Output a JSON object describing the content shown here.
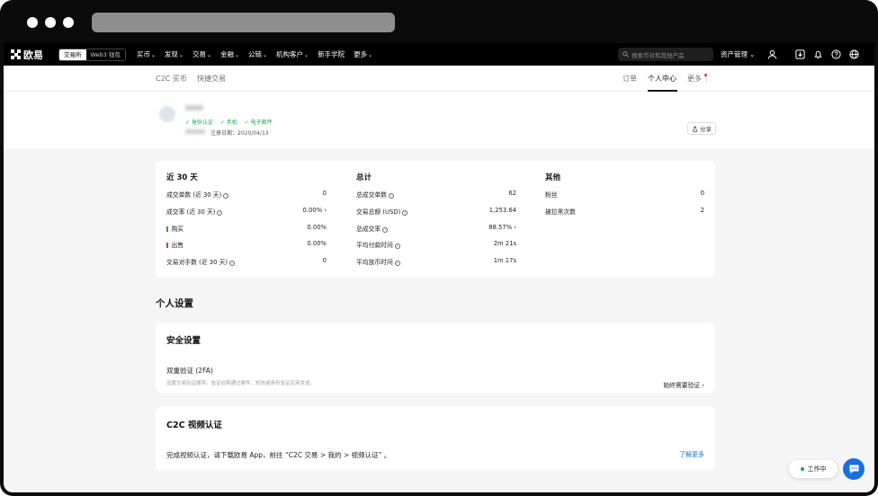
{
  "nav": {
    "logo_text": "欧易",
    "seg_exchange": "交易所",
    "seg_wallet": "Web3 钱包",
    "menu": [
      "买币",
      "发现",
      "交易",
      "金融",
      "公链",
      "机构客户",
      "新手学院",
      "更多"
    ],
    "search_placeholder": "搜索币对和其他产品",
    "asset_label": "资产管理"
  },
  "subnav": {
    "left_tabs": [
      "C2C 买币",
      "快捷交易"
    ],
    "right_tabs": [
      "订单",
      "个人中心",
      "更多"
    ],
    "active_tab": "个人中心"
  },
  "profile": {
    "verifications": [
      "✓ 身份认证",
      "✓ 手机",
      "✓ 电子邮件"
    ],
    "register_date": "注册日期：2020/04/13",
    "share_label": "分享"
  },
  "stats": {
    "recent": {
      "title": "近 30 天",
      "rows": [
        {
          "label": "成交单数 (近 30 天)",
          "value": "0"
        },
        {
          "label": "成交率 (近 30 天)",
          "value": "0.00%"
        },
        {
          "label": "购买",
          "value": "0.00%"
        },
        {
          "label": "出售",
          "value": "0.00%"
        },
        {
          "label": "交易对手数 (近 30 天)",
          "value": "0"
        }
      ]
    },
    "total": {
      "title": "总计",
      "rows": [
        {
          "label": "总成交单数",
          "value": "62"
        },
        {
          "label": "交易总额 (USD)",
          "value": "1,253.64"
        },
        {
          "label": "总成交率",
          "value": "88.57%"
        },
        {
          "label": "平均付款时间",
          "value": "2m 21s"
        },
        {
          "label": "平均放币时间",
          "value": "1m 17s"
        }
      ]
    },
    "other": {
      "title": "其他",
      "rows": [
        {
          "label": "粉丝",
          "value": "0"
        },
        {
          "label": "被拉黑次数",
          "value": "2"
        }
      ]
    }
  },
  "settings": {
    "section_title": "个人设置",
    "security_title": "安全设置",
    "twofa_label": "双重验证 (2FA)",
    "twofa_desc": "设置交易验证顺序。验证码将通过邮件、短信或身份验证应用发送。",
    "always_label": "始终需要验证",
    "c2c_title": "C2C 视频认证",
    "c2c_desc": "完成视频认证，请下载欧易 App，前往 “C2C 交易 > 我的 > 视频认证” 。",
    "learn_more": "了解更多"
  },
  "widgets": {
    "work_label": "工作中"
  },
  "colors": {
    "green": "#1aa54b",
    "red": "#e0344f",
    "link_blue": "#1a6fe0"
  }
}
